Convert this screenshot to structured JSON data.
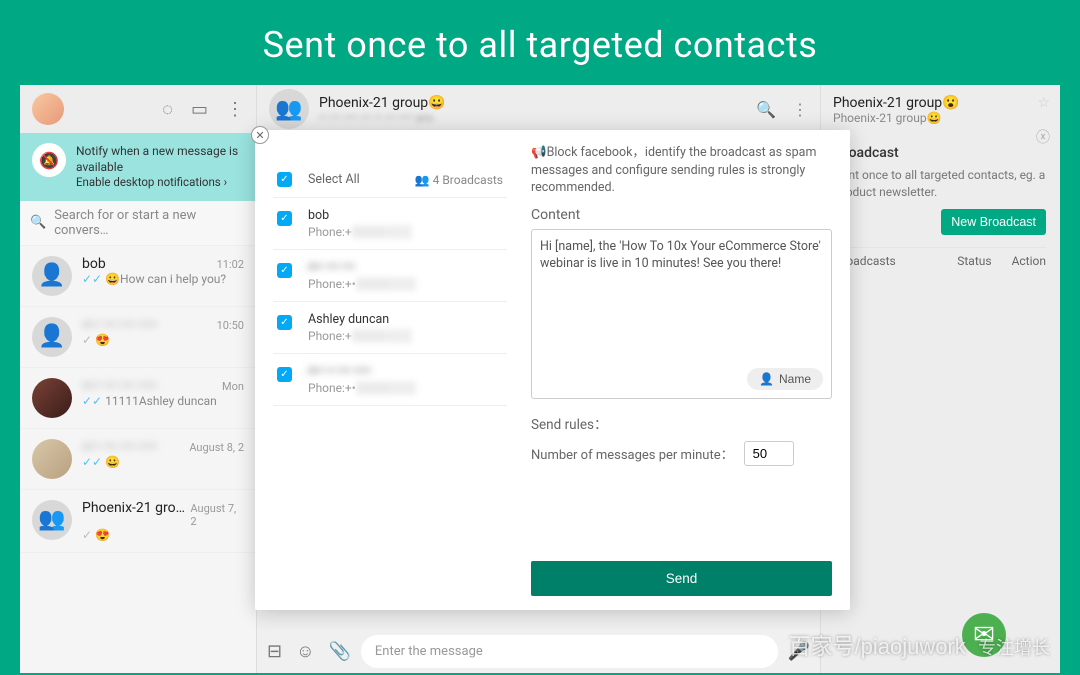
{
  "banner": "Sent once to all targeted contacts",
  "notify": {
    "title": "Notify when a new message is available",
    "link": "Enable desktop notifications ›"
  },
  "search": {
    "placeholder": "Search for or start a new convers…"
  },
  "chats": [
    {
      "name": "bob",
      "time": "11:02",
      "preview": "😀How can i help you?",
      "tick": true
    },
    {
      "name": "+•• ••• ••• ••••",
      "time": "10:50",
      "preview": "😍",
      "tick": false,
      "blur": true
    },
    {
      "name": "+•• ••• ••• ••••",
      "time": "Mon",
      "preview": "11111Ashley duncan",
      "tick": true,
      "blur": true
    },
    {
      "name": "+•• ••• ••• ••••",
      "time": "August 8, 2",
      "preview": "😀",
      "tick": true,
      "blur": true
    },
    {
      "name": "Phoenix-21 grou…",
      "time": "August 7, 2",
      "preview": "😍",
      "tick": false
    }
  ],
  "middle": {
    "title": "Phoenix-21 group😀",
    "subtitle": "•• ••• •••• ••• •• ••• •••• you"
  },
  "right": {
    "title": "Phoenix-21 group😮",
    "subtitle": "Phoenix-21 group😀",
    "sectionTitle": "Broadcast",
    "desc": "Sent once to all targeted contacts, eg. a product newsletter.",
    "newBtn": "New Broadcast",
    "col1": "Broadcasts",
    "col2": "Status",
    "col3": "Action"
  },
  "modal": {
    "selectAll": "Select All",
    "broadcastCount": "4 Broadcasts",
    "contacts": [
      {
        "name": "bob",
        "phone": "Phone:+"
      },
      {
        "name": "+•• ••• •••",
        "phone": "Phone:+•",
        "blurName": true
      },
      {
        "name": "Ashley duncan",
        "phone": "Phone:+"
      },
      {
        "name": "+•• •• ••• ••••",
        "phone": "Phone:+•",
        "blurName": true
      }
    ],
    "warning": "📢Block facebook，identify the broadcast as spam messages and configure sending rules is strongly recommended.",
    "contentLabel": "Content",
    "contentText": "Hi [name], the 'How To 10x Your eCommerce Store' webinar is live in 10 minutes! See you there!",
    "nameBtn": "Name",
    "rulesLabel": "Send rules：",
    "perMin": "Number of messages per minute：",
    "perMinVal": "50",
    "sendBtn": "Send"
  },
  "msgbar": {
    "placeholder": "Enter the message"
  },
  "watermark": "百家号/piaojuwork",
  "watermark2": "专注增长"
}
